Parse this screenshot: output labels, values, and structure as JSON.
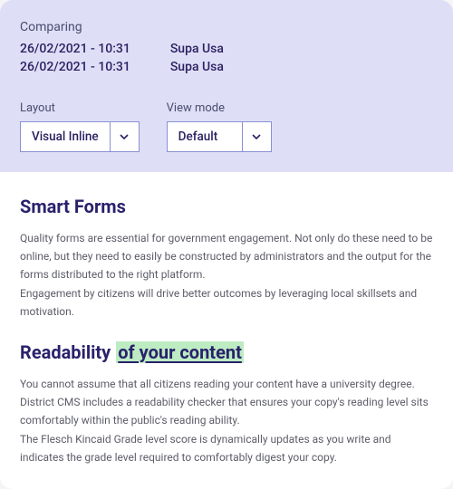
{
  "header": {
    "comparing_label": "Comparing",
    "rows": [
      {
        "date": "26/02/2021 - 10:31",
        "user": "Supa Usa"
      },
      {
        "date": "26/02/2021 - 10:31",
        "user": "Supa Usa"
      }
    ],
    "layout": {
      "label": "Layout",
      "value": "Visual Inline"
    },
    "viewmode": {
      "label": "View mode",
      "value": "Default"
    }
  },
  "content": {
    "smart_forms_title": "Smart Forms",
    "smart_forms_p1": "Quality forms are essential for government engagement. Not only do these need to be online, but they need to easily be constructed by administrators and the output for the forms distributed to the right platform.",
    "smart_forms_p2": "Engagement by citizens will drive better outcomes by leveraging local skillsets and motivation.",
    "readability_title_plain": "Readability",
    "readability_title_highlight": "of your content",
    "readability_p1": "You cannot assume that all citizens reading your content have a university degree. District CMS includes a readability checker that ensures your copy's reading level sits comfortably within the public's reading ability.",
    "readability_p2": "The Flesch Kincaid Grade level score is dynamically updates as you write and indicates the grade level required to comfortably digest your copy."
  }
}
